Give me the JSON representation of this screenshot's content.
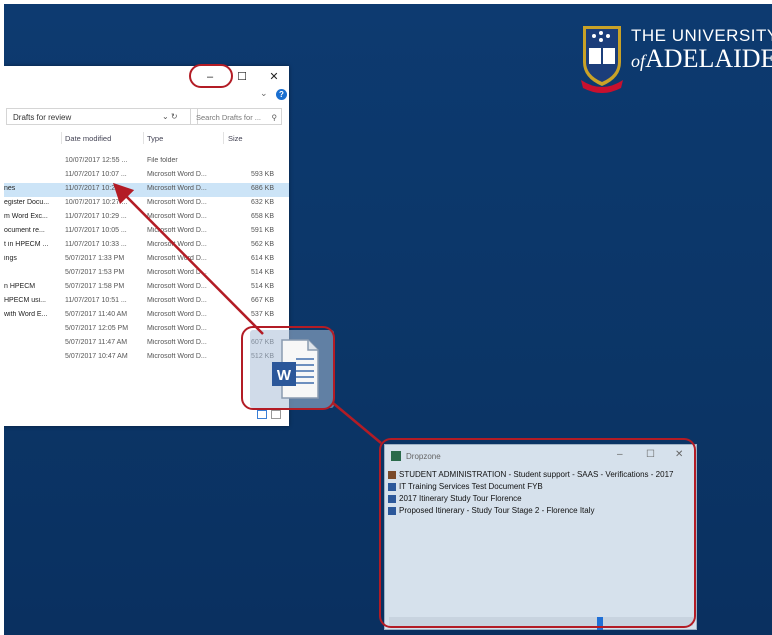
{
  "university": {
    "line1": "THE UNIVERSITY",
    "line2_of": "of",
    "line2_name": "ADELAIDE"
  },
  "explorer": {
    "min_btn": "–",
    "max_btn": "☐",
    "close_btn": "✕",
    "chevron": "⌄",
    "help": "?",
    "address": "Drafts for review",
    "addr_controls": "⌄ ↻",
    "search_placeholder": "Search Drafts for ...",
    "search_icon": "⚲",
    "columns": {
      "date": "Date modified",
      "type": "Type",
      "size": "Size"
    },
    "rows": [
      {
        "name": "",
        "date": "10/07/2017 12:55 ...",
        "type": "File folder",
        "size": ""
      },
      {
        "name": "",
        "date": "11/07/2017 10:07 ...",
        "type": "Microsoft Word D...",
        "size": "593 KB"
      },
      {
        "name": "nes",
        "date": "11/07/2017 10:22 ...",
        "type": "Microsoft Word D...",
        "size": "686 KB"
      },
      {
        "name": "egister Docu...",
        "date": "10/07/2017 10:27 ...",
        "type": "Microsoft Word D...",
        "size": "632 KB"
      },
      {
        "name": "m Word Exc...",
        "date": "11/07/2017 10:29 ...",
        "type": "Microsoft Word D...",
        "size": "658 KB"
      },
      {
        "name": "ocument re...",
        "date": "11/07/2017 10:05 ...",
        "type": "Microsoft Word D...",
        "size": "591 KB"
      },
      {
        "name": "t in HPECM ...",
        "date": "11/07/2017 10:33 ...",
        "type": "Microsoft Word D...",
        "size": "562 KB"
      },
      {
        "name": "ings",
        "date": "5/07/2017 1:33 PM",
        "type": "Microsoft Word D...",
        "size": "614 KB"
      },
      {
        "name": "",
        "date": "5/07/2017 1:53 PM",
        "type": "Microsoft Word D...",
        "size": "514 KB"
      },
      {
        "name": "n HPECM",
        "date": "5/07/2017 1:58 PM",
        "type": "Microsoft Word D...",
        "size": "514 KB"
      },
      {
        "name": "HPECM usi...",
        "date": "11/07/2017 10:51 ...",
        "type": "Microsoft Word D...",
        "size": "667 KB"
      },
      {
        "name": "with Word E...",
        "date": "5/07/2017 11:40 AM",
        "type": "Microsoft Word D...",
        "size": "537 KB"
      },
      {
        "name": "",
        "date": "5/07/2017 12:05 PM",
        "type": "Microsoft Word D...",
        "size": ""
      },
      {
        "name": "",
        "date": "5/07/2017 11:47 AM",
        "type": "Microsoft Word D...",
        "size": "607 KB"
      },
      {
        "name": "",
        "date": "5/07/2017 10:47 AM",
        "type": "Microsoft Word D...",
        "size": "512 KB"
      }
    ]
  },
  "drag_icon": {
    "letter": "W"
  },
  "dropzone": {
    "title": "Dropzone",
    "min_btn": "–",
    "max_btn": "☐",
    "close_btn": "✕",
    "items": [
      {
        "label": "STUDENT ADMINISTRATION - Student support - SAAS - Verifications - 2017",
        "color": "#7a4a2a"
      },
      {
        "label": "IT Training Services Test Document FYB",
        "color": "#2b579a"
      },
      {
        "label": "2017 Itinerary Study Tour Florence",
        "color": "#2b579a"
      },
      {
        "label": "Proposed Itinerary - Study Tour Stage 2 - Florence Italy",
        "color": "#2b579a"
      }
    ]
  },
  "colors": {
    "highlight": "#b31c25",
    "background": "#0b3566",
    "word_blue": "#2b579a"
  }
}
